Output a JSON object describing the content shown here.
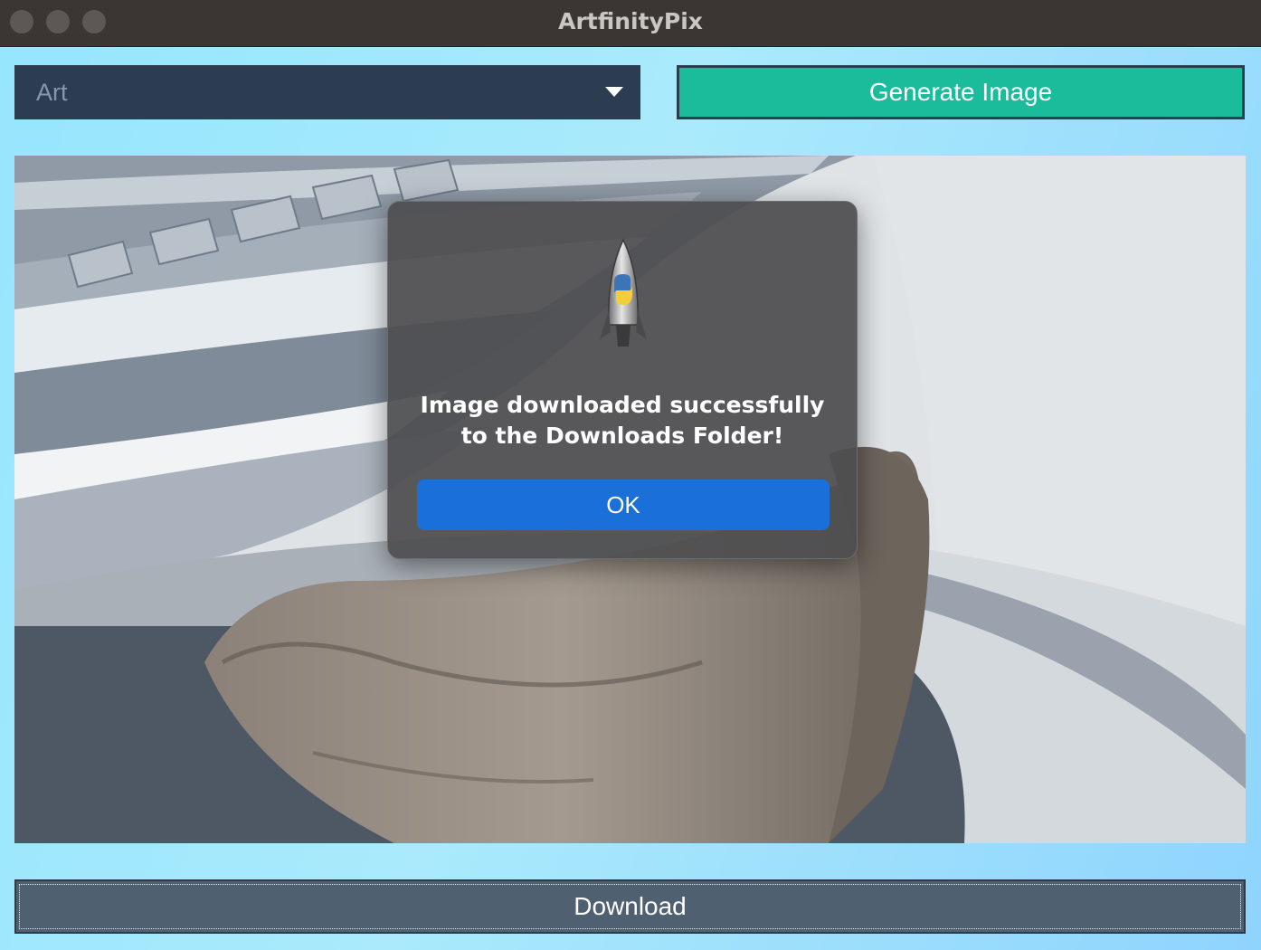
{
  "window": {
    "title": "ArtfinityPix"
  },
  "toolbar": {
    "category_selected": "Art",
    "generate_label": "Generate Image"
  },
  "image": {
    "icon": "generated-image"
  },
  "footer": {
    "download_label": "Download"
  },
  "dialog": {
    "message": "Image downloaded successfully\nto the Downloads Folder!",
    "ok_label": "OK",
    "icon": "python-launcher-icon"
  },
  "colors": {
    "accent": "#1abc9c",
    "dropdown_bg": "#2c3d52",
    "dialog_button": "#1a6fd9",
    "download_bg": "#4f6070"
  }
}
